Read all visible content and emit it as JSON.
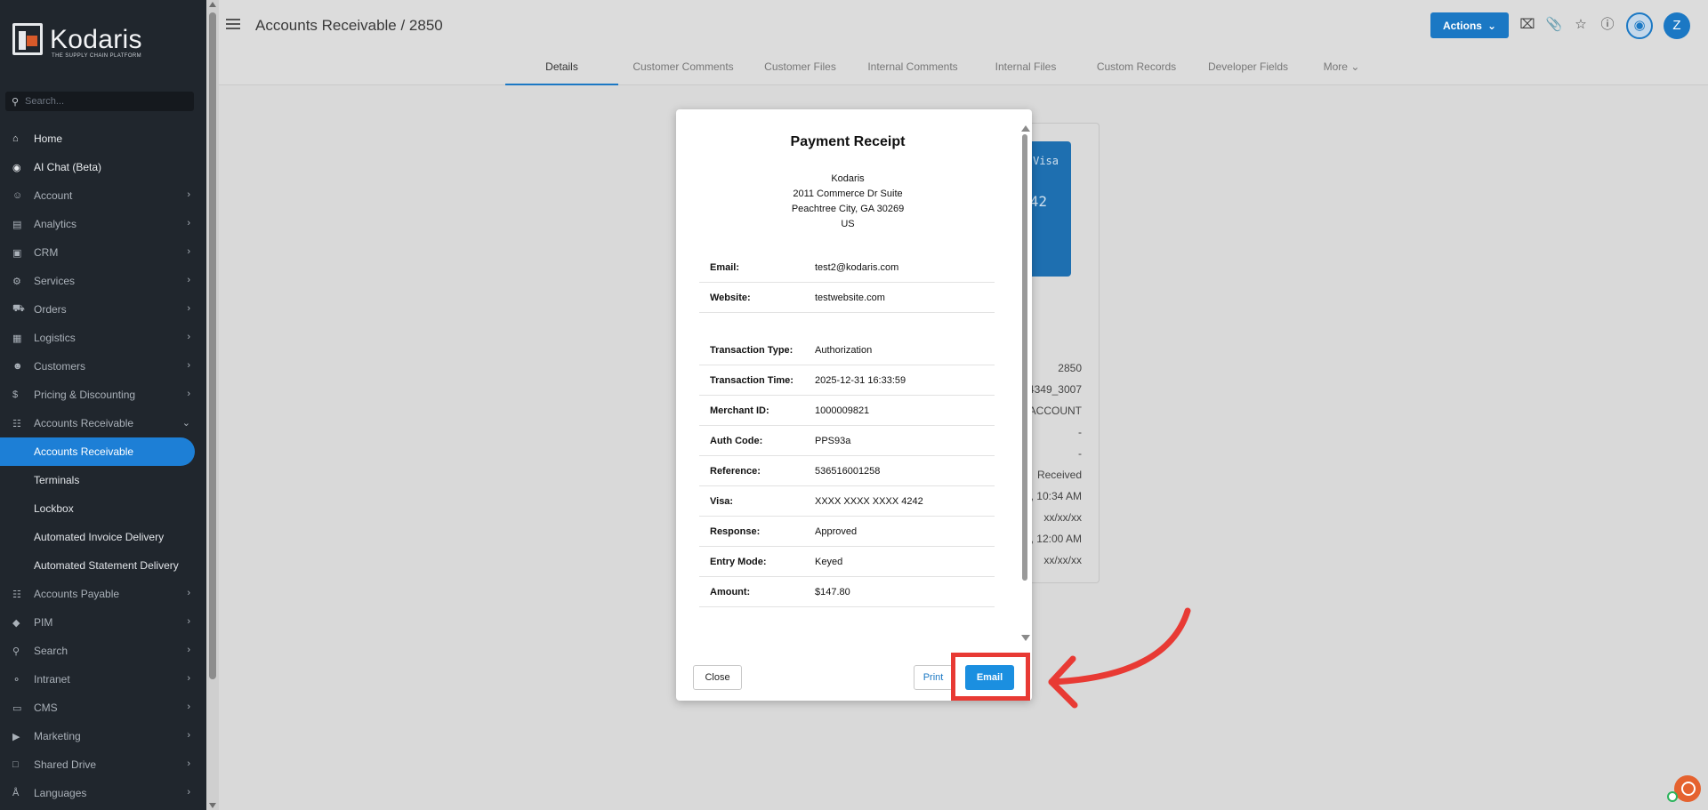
{
  "sidebar": {
    "logo_text": "Kodaris",
    "logo_sub": "THE SUPPLY CHAIN PLATFORM",
    "search_placeholder": "Search...",
    "items": [
      {
        "label": "Home",
        "icon": "home-icon"
      },
      {
        "label": "AI Chat (Beta)",
        "icon": "robot-icon"
      },
      {
        "label": "Account",
        "icon": "user-icon"
      },
      {
        "label": "Analytics",
        "icon": "chart-icon"
      },
      {
        "label": "CRM",
        "icon": "contact-card-icon"
      },
      {
        "label": "Services",
        "icon": "services-icon"
      },
      {
        "label": "Orders",
        "icon": "truck-icon"
      },
      {
        "label": "Logistics",
        "icon": "forklift-icon"
      },
      {
        "label": "Customers",
        "icon": "people-icon"
      },
      {
        "label": "Pricing & Discounting",
        "icon": "dollar-icon"
      },
      {
        "label": "Accounts Receivable",
        "icon": "bank-icon"
      }
    ],
    "sub_items": [
      {
        "label": "Accounts Receivable"
      },
      {
        "label": "Terminals"
      },
      {
        "label": "Lockbox"
      },
      {
        "label": "Automated Invoice Delivery"
      },
      {
        "label": "Automated Statement Delivery"
      }
    ],
    "items_after": [
      {
        "label": "Accounts Payable",
        "icon": "bank-icon"
      },
      {
        "label": "PIM",
        "icon": "tag-icon"
      },
      {
        "label": "Search",
        "icon": "search-icon"
      },
      {
        "label": "Intranet",
        "icon": "globe-icon"
      },
      {
        "label": "CMS",
        "icon": "window-icon"
      },
      {
        "label": "Marketing",
        "icon": "megaphone-icon"
      },
      {
        "label": "Shared Drive",
        "icon": "folder-icon"
      },
      {
        "label": "Languages",
        "icon": "translate-icon"
      }
    ]
  },
  "header": {
    "title": "Accounts Receivable / 2850",
    "actions_label": "Actions",
    "avatar_letter": "Z"
  },
  "tabs": [
    {
      "label": "Details",
      "active": true
    },
    {
      "label": "Customer Comments"
    },
    {
      "label": "Customer Files"
    },
    {
      "label": "Internal Comments"
    },
    {
      "label": "Internal Files"
    },
    {
      "label": "Custom Records"
    },
    {
      "label": "Developer Fields"
    },
    {
      "label": "More"
    }
  ],
  "background_card": {
    "visa_text": "Visa",
    "card_num_fragment": "42",
    "values": [
      "2850",
      "4349_3007",
      "ACCOUNT",
      "-",
      "-",
      "Received",
      ", 10:34 AM",
      "xx/xx/xx",
      ", 12:00 AM",
      "xx/xx/xx"
    ]
  },
  "modal": {
    "title": "Payment Receipt",
    "address": [
      "Kodaris",
      "2011 Commerce Dr Suite",
      "Peachtree City, GA 30269",
      "US"
    ],
    "contact_rows": [
      {
        "key": "Email:",
        "value": "test2@kodaris.com"
      },
      {
        "key": "Website:",
        "value": "testwebsite.com"
      }
    ],
    "transaction_rows": [
      {
        "key": "Transaction Type:",
        "value": "Authorization"
      },
      {
        "key": "Transaction Time:",
        "value": "2025-12-31 16:33:59"
      },
      {
        "key": "Merchant ID:",
        "value": "1000009821"
      },
      {
        "key": "Auth Code:",
        "value": "PPS93a"
      },
      {
        "key": "Reference:",
        "value": "536516001258"
      },
      {
        "key": "Visa:",
        "value": "XXXX XXXX XXXX 4242"
      },
      {
        "key": "Response:",
        "value": "Approved"
      },
      {
        "key": "Entry Mode:",
        "value": "Keyed"
      },
      {
        "key": "Amount:",
        "value": "$147.80"
      }
    ],
    "close_label": "Close",
    "print_label": "Print",
    "email_label": "Email"
  },
  "colors": {
    "accent": "#1b78c4",
    "highlight": "#e83a34",
    "sidebar_bg": "#20262d"
  }
}
